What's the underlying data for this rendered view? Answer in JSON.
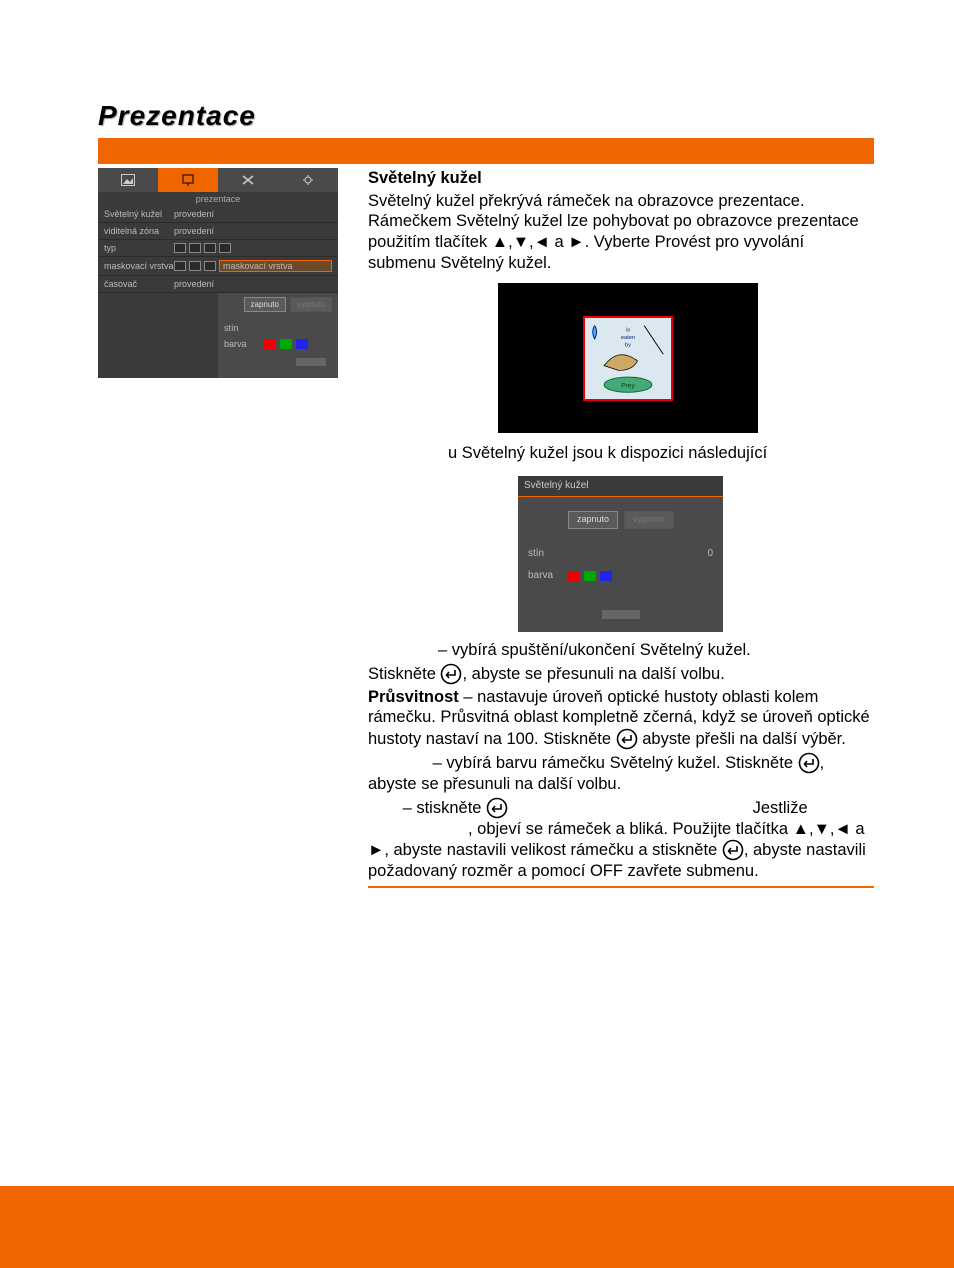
{
  "page": {
    "title": "Prezentace"
  },
  "menu": {
    "subtitle": "prezentace",
    "rows": {
      "r1_label": "Světelný kužel",
      "r1_value": "provedení",
      "r2_label": "viditelná zóna",
      "r2_value": "provedení",
      "r3_label": "typ",
      "r4_label": "maskovací vrstva",
      "r4_highlight": "maskovací vrstva",
      "r5_label": "časovač",
      "r5_value": "provedení"
    },
    "sub": {
      "btn_on": "zapnuto",
      "btn_off": "vypnuto",
      "row_shade": "stín",
      "row_color": "barva"
    }
  },
  "submenu": {
    "title": "Světelný kužel",
    "btn_on": "zapnuto",
    "btn_off": "vypnuto",
    "row_shade": "stín",
    "shade_val": "0",
    "row_color": "barva"
  },
  "text": {
    "h1": "Světelný kužel",
    "p1": "Světelný kužel překrývá rámeček na obrazovce prezentace. Rámečkem Světelný kužel lze pohybovat po obrazovce prezentace použitím tlačítek ▲,▼,◄ a ►. Vyberte Provést pro vyvolání submenu Světelný kužel.",
    "p2": "u Světelný kužel jsou k dispozici následující",
    "line_on": " – vybírá spuštění/ukončení Světelný kužel.",
    "line_press": "Stiskněte ",
    "line_press2": ", abyste se přesunuli na další volbu.",
    "shade_label": "Průsvitnost",
    "shade_text": " – nastavuje úroveň optické hustoty oblasti kolem rámečku. Průsvitná oblast kompletně zčerná, když se úroveň optické hustoty nastaví na 100. Stiskněte ",
    "shade_text2": " abyste přešli na další výběr.",
    "color_text": " – vybírá barvu rámečku Světelný kužel. Stiskněte ",
    "color_text2": ", abyste se přesunuli na další volbu.",
    "slider_pre": " – stiskněte ",
    "slider_post": " Jestliže ",
    "slider_line2": ", objeví se rámeček a bliká. Použijte tlačítka ▲,▼,◄ a ►, abyste nastavili velikost rámečku a stiskněte ",
    "slider_line3": ", abyste nastavili požadovaný rozměr a pomocí OFF zavřete submenu."
  }
}
